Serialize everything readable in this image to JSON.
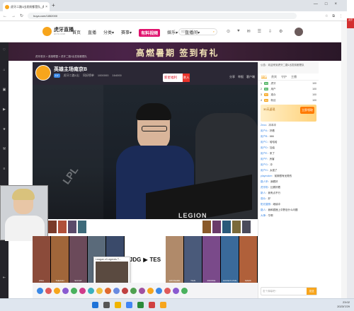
{
  "browser": {
    "tab_title": "虎牙二路1出发前都是队_虎牙",
    "tab_close": "×",
    "new_tab": "+",
    "url": "huya.com/1852000",
    "win_controls": [
      "—",
      "□",
      "×"
    ]
  },
  "header": {
    "logo_name": "虎牙直播",
    "logo_sub": "HUYA.COM",
    "nav": [
      "首页",
      "直播",
      "分类▾",
      "赛事▾",
      "有料视频",
      "娱乐▾",
      "直播间▾"
    ],
    "nav_hot_index": 4,
    "search_placeholder": "搜索",
    "icons": [
      "⊙",
      "♥",
      "✉",
      "☰",
      "⇩",
      "⚙"
    ]
  },
  "banner": {
    "text": "高燃暑期 签到有礼",
    "crumb": "虎牙首页 > 英雄联盟 > 虎牙二路1出发前都是队"
  },
  "room": {
    "title": "英雄主场南京B",
    "level": "LV",
    "meta": [
      "虎牙二路1出",
      "同好榜单",
      "1000000",
      "164000"
    ],
    "welfare": "新星福利",
    "welfare_go": "进入",
    "actions": [
      "分享",
      "举报",
      "客户端"
    ]
  },
  "video": {
    "legion_text": "LEGION",
    "lpl_text": "LPL"
  },
  "champions": {
    "left": [
      "ZIKA",
      "THEXAN",
      "SCOUT",
      "",
      ""
    ],
    "vs_left": "JDG",
    "vs_right": "TES",
    "right": [
      "WAYWARD",
      "TIAN",
      "ROOKIE",
      "JACKEYLOVE",
      "MARK"
    ]
  },
  "popup": {
    "title": "League of Legends T..."
  },
  "chat": {
    "announcement": "公告：欢迎来到虎牙二路1出发前都是队",
    "tabs": [
      "排行",
      "贵宾",
      "守护",
      "主播"
    ],
    "fans": [
      {
        "rank": "1",
        "name": "虎牙",
        "badge": "NO",
        "score": "100"
      },
      {
        "rank": "2",
        "name": "用户",
        "badge": "NO",
        "score": "100"
      },
      {
        "rank": "3",
        "name": "观众",
        "badge": "NO",
        "score": "100"
      },
      {
        "rank": "4",
        "name": "粉丝",
        "badge": "NO",
        "score": "100"
      }
    ],
    "promo_text": "30天返现",
    "promo_btn": "立即领取",
    "messages": [
      {
        "user": "Zeus",
        "text": "冲冲冲"
      },
      {
        "user": "用户A",
        "text": "好看"
      },
      {
        "user": "用户B",
        "text": "666"
      },
      {
        "user": "用户C",
        "text": "哈哈哈"
      },
      {
        "user": "用户D",
        "text": "加油"
      },
      {
        "user": "用户E",
        "text": "来了"
      },
      {
        "user": "用户F",
        "text": "厉害"
      },
      {
        "user": "用户G",
        "text": "冲"
      },
      {
        "user": "用户H",
        "text": "太强了"
      },
      {
        "user": "playmaker",
        "text": "前期很有优势的"
      },
      {
        "user": "路人甲",
        "text": "我看好"
      },
      {
        "user": "虎牙粉",
        "text": "比赛好看"
      },
      {
        "user": "新人",
        "text": "我有点不行"
      },
      {
        "user": "观众",
        "text": "好"
      },
      {
        "user": "阳光普照",
        "text": "继续冲"
      },
      {
        "user": "路人",
        "text": "我和狐狸上中野没什么问题"
      },
      {
        "user": "大神",
        "text": "牛啊"
      }
    ],
    "input_placeholder": "发个弹幕吧~",
    "send": "发送"
  },
  "gutter_chip": "虎牙",
  "taskbar": {
    "time": "23:02",
    "date": "2023/7/29"
  },
  "colors": {
    "brand": "#f7a51c",
    "hot": "#e0116c"
  }
}
